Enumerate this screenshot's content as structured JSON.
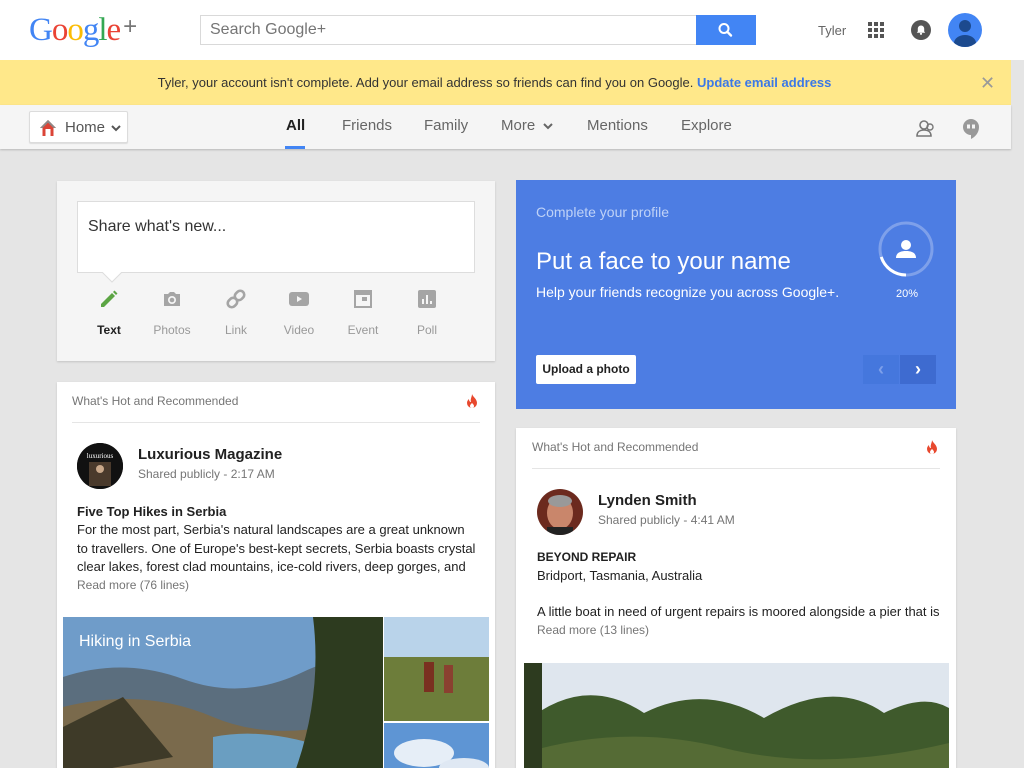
{
  "header": {
    "logo_parts": [
      "G",
      "o",
      "o",
      "g",
      "l",
      "e"
    ],
    "logo_plus": "+",
    "search_placeholder": "Search Google+",
    "user_name": "Tyler",
    "icons": [
      "search-icon",
      "apps-grid-icon",
      "notification-bell-icon",
      "avatar"
    ]
  },
  "banner": {
    "text": "Tyler, your account isn't complete. Add your email address so friends can find you on Google.",
    "link": "Update email address",
    "close": "✕"
  },
  "nav": {
    "home_label": "Home",
    "tabs": [
      {
        "label": "All",
        "active": true
      },
      {
        "label": "Friends"
      },
      {
        "label": "Family"
      },
      {
        "label": "More"
      },
      {
        "label": "Mentions"
      },
      {
        "label": "Explore"
      }
    ],
    "icons": [
      "people-icon",
      "hangouts-icon"
    ]
  },
  "share": {
    "placeholder": "Share what's new...",
    "types": [
      {
        "label": "Text",
        "icon": "pencil-icon",
        "active": true
      },
      {
        "label": "Photos",
        "icon": "camera-icon"
      },
      {
        "label": "Link",
        "icon": "link-icon"
      },
      {
        "label": "Video",
        "icon": "video-icon"
      },
      {
        "label": "Event",
        "icon": "event-icon"
      },
      {
        "label": "Poll",
        "icon": "poll-icon"
      }
    ]
  },
  "profile": {
    "kicker": "Complete your profile",
    "heading": "Put a face to your name",
    "sub": "Help your friends recognize you across Google+.",
    "percent": "20%",
    "progress": 0.2,
    "upload_label": "Upload a photo",
    "prev_label": "‹",
    "next_label": "›"
  },
  "posts": [
    {
      "section": "What's Hot and Recommended",
      "author": "Luxurious Magazine",
      "visibility": "Shared publicly",
      "time": "2:17 AM",
      "title": "Five Top Hikes in Serbia",
      "body": "For the most part, Serbia's natural landscapes are a great unknown to travellers. One of Europe's best-kept secrets, Serbia boasts crystal clear lakes, forest clad mountains, ice-cold rivers, deep gorges, and",
      "more": "Read more (76 lines)",
      "album_caption": "Hiking in Serbia",
      "avatar_text": "luxurious"
    },
    {
      "section": "What's Hot and Recommended",
      "author": "Lynden Smith",
      "visibility": "Shared publicly",
      "time": "4:41 AM",
      "title": "BEYOND REPAIR",
      "subtitle": "Bridport, Tasmania, Australia",
      "body": "A little boat in need of urgent repairs is moored alongside a pier that is",
      "more": "Read more (13 lines)"
    }
  ],
  "colors": {
    "blue": "#4285f4",
    "profile_blue": "#4d7de3",
    "banner_yellow": "#ffe88a",
    "link_blue": "#3b78e7",
    "fire_red": "#e8482e"
  }
}
